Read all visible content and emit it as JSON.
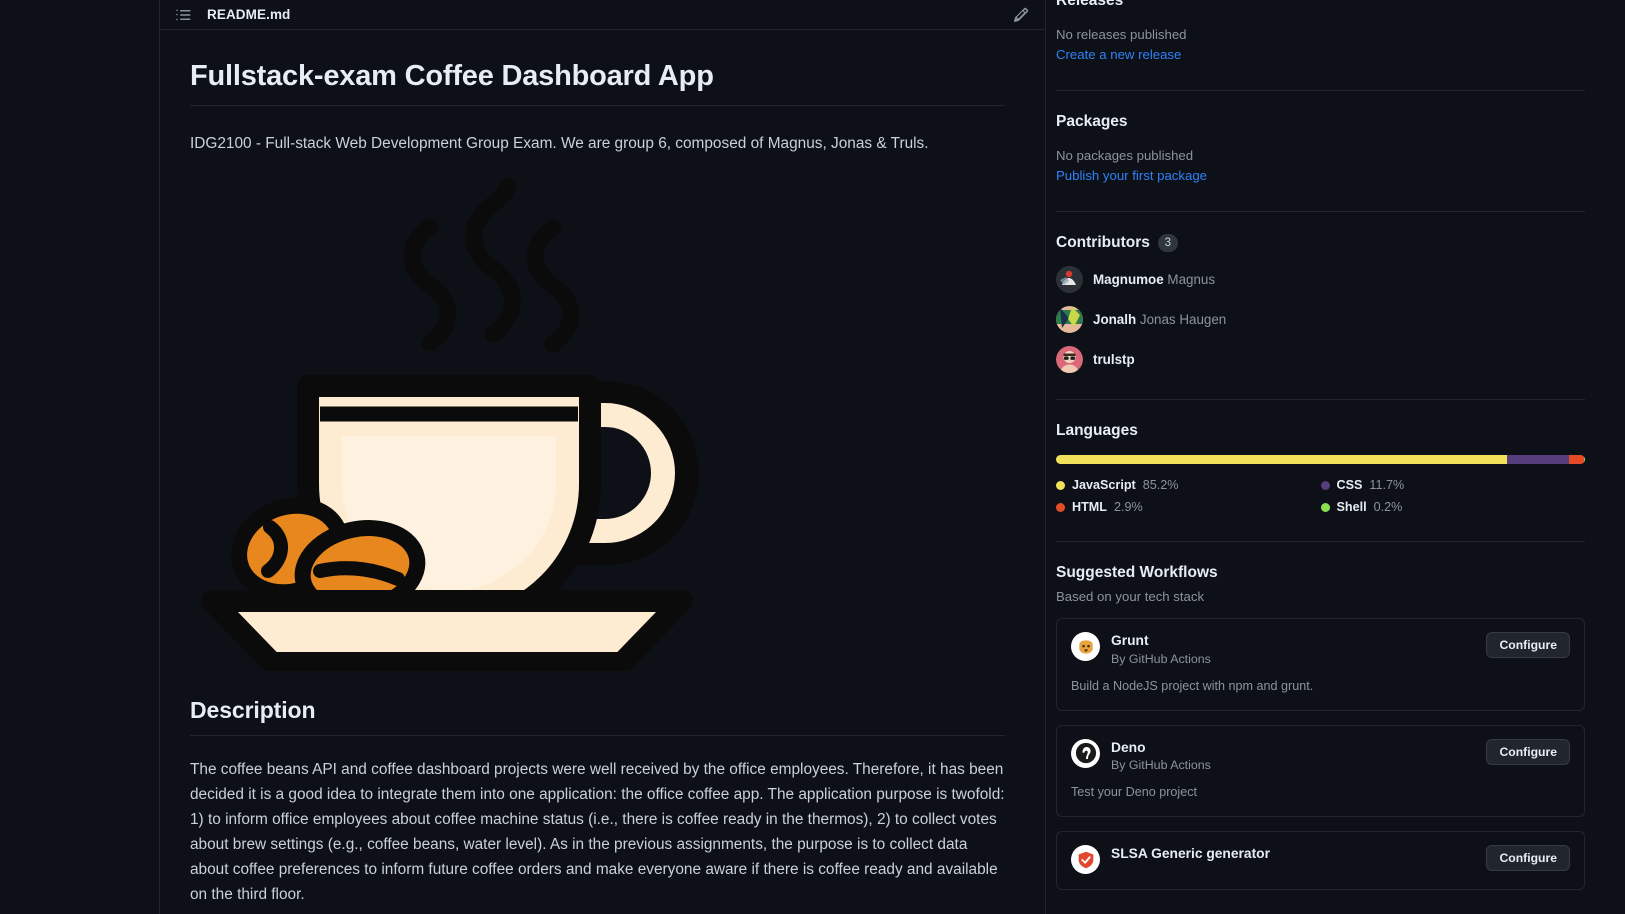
{
  "readme": {
    "filename": "README.md",
    "outline_icon": "list-unordered-icon",
    "edit_icon": "pencil-icon",
    "title": "Fullstack-exam Coffee Dashboard App",
    "intro": "IDG2100 - Full-stack Web Development Group Exam. We are group 6, composed of Magnus, Jonas & Truls.",
    "image_alt": "coffee-cup-illustration",
    "description_heading": "Description",
    "description_text": "The coffee beans API and coffee dashboard projects were well received by the office employees. Therefore, it has been decided it is a good idea to integrate them into one application: the office coffee app. The application purpose is twofold: 1) to inform office employees about coffee machine status (i.e., there is coffee ready in the thermos), 2) to collect votes about brew settings (e.g., coffee beans, water level). As in the previous assignments, the purpose is to collect data about coffee preferences to inform future coffee orders and make everyone aware if there is coffee ready and available on the third floor."
  },
  "sidebar": {
    "releases": {
      "title": "Releases",
      "empty_text": "No releases published",
      "link_text": "Create a new release"
    },
    "packages": {
      "title": "Packages",
      "empty_text": "No packages published",
      "link_text": "Publish your first package"
    },
    "contributors": {
      "title": "Contributors",
      "count": "3",
      "items": [
        {
          "username": "Magnumoe",
          "fullname": "Magnus"
        },
        {
          "username": "Jonalh",
          "fullname": "Jonas Haugen"
        },
        {
          "username": "trulstp",
          "fullname": ""
        }
      ]
    },
    "languages": {
      "title": "Languages",
      "items": [
        {
          "name": "JavaScript",
          "percent": "85.2%",
          "color": "#f1e05a",
          "width": 85.2
        },
        {
          "name": "CSS",
          "percent": "11.7%",
          "color": "#563d7c",
          "width": 11.7
        },
        {
          "name": "HTML",
          "percent": "2.9%",
          "color": "#e34c26",
          "width": 2.9
        },
        {
          "name": "Shell",
          "percent": "0.2%",
          "color": "#89e051",
          "width": 0.2
        }
      ]
    },
    "workflows": {
      "title": "Suggested Workflows",
      "subtitle": "Based on your tech stack",
      "configure_label": "Configure",
      "items": [
        {
          "name": "Grunt",
          "by": "By GitHub Actions",
          "description": "Build a NodeJS project with npm and grunt.",
          "logo": "grunt-logo"
        },
        {
          "name": "Deno",
          "by": "By GitHub Actions",
          "description": "Test your Deno project",
          "logo": "deno-logo"
        },
        {
          "name": "SLSA Generic generator",
          "by": "",
          "description": "",
          "logo": "slsa-logo"
        }
      ]
    }
  }
}
